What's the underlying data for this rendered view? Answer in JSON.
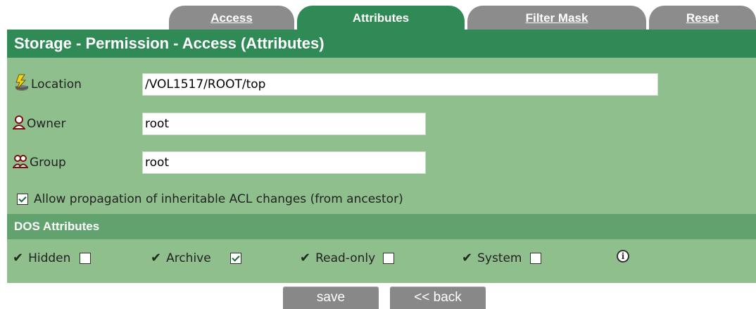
{
  "tabs": [
    {
      "label": "Access",
      "active": false
    },
    {
      "label": "Attributes",
      "active": true
    },
    {
      "label": "Filter Mask",
      "active": false
    },
    {
      "label": "Reset",
      "active": false
    }
  ],
  "title": "Storage - Permission - Access (Attributes)",
  "fields": {
    "location": {
      "label": "Location",
      "value": "/VOL1517/ROOT/top",
      "icon": "location-lightning-icon"
    },
    "owner": {
      "label": "Owner",
      "value": "root",
      "icon": "user-icon"
    },
    "group": {
      "label": "Group",
      "value": "root",
      "icon": "group-icon"
    }
  },
  "propagate": {
    "label": "Allow propagation of inheritable ACL changes (from ancestor)",
    "checked": true
  },
  "dos": {
    "title": "DOS Attributes",
    "attributes": [
      {
        "label": "Hidden",
        "checked": false
      },
      {
        "label": "Archive",
        "checked": true
      },
      {
        "label": "Read-only",
        "checked": false
      },
      {
        "label": "System",
        "checked": false
      }
    ]
  },
  "buttons": {
    "save": "save",
    "back": "<< back"
  },
  "colors": {
    "primary": "#2f8a55",
    "panel": "#90bf8e",
    "dos_bar": "#62a26f",
    "tab_inactive": "#8c8c8c"
  }
}
